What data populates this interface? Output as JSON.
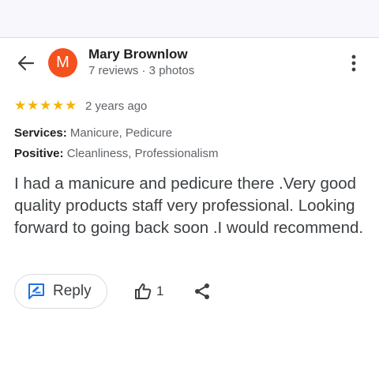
{
  "reviewer": {
    "avatar_initial": "M",
    "avatar_color": "#f4511e",
    "name": "Mary Brownlow",
    "meta": "7 reviews · 3 photos"
  },
  "rating": {
    "stars": 5,
    "max_stars": 5,
    "star_color": "#f4b400",
    "date": "2 years ago"
  },
  "attributes": [
    {
      "label": "Services:",
      "value": "Manicure, Pedicure"
    },
    {
      "label": "Positive:",
      "value": "Cleanliness, Professionalism"
    }
  ],
  "review_text": "I had a manicure and pedicure there .Very good quality products staff very professional. Looking forward to going back soon .I would recommend.",
  "actions": {
    "reply_label": "Reply",
    "like_count": "1"
  },
  "icons": {
    "back": "back-arrow-icon",
    "more": "more-vert-icon",
    "reply": "reply-edit-icon",
    "like": "thumbs-up-icon",
    "share": "share-icon"
  },
  "colors": {
    "accent": "#1a73e8",
    "text_secondary": "#5f6368"
  }
}
